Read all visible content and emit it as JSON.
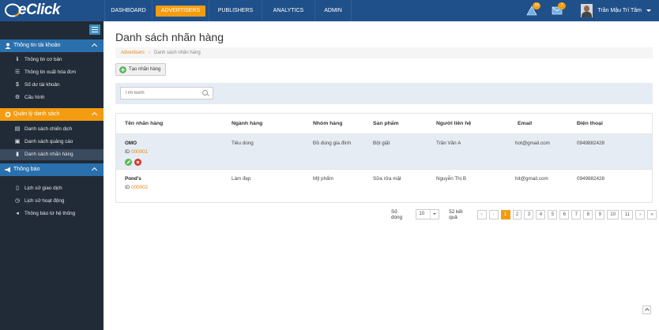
{
  "app": {
    "logo_text": "eClick"
  },
  "nav": [
    {
      "label": "DASHBOARD"
    },
    {
      "label": "ADVERTISERS",
      "active": true
    },
    {
      "label": "PUBLISHERS"
    },
    {
      "label": "ANALYTICS"
    },
    {
      "label": "ADMIN"
    }
  ],
  "notifications": {
    "alerts": "18",
    "messages": "7"
  },
  "user": {
    "name": "Trần Mậu Trí Tâm"
  },
  "sidebar": {
    "sections": [
      {
        "title": "Thông tin tài khoản",
        "items": [
          "Thông tin cơ bản",
          "Thông tin xuất hóa đơn",
          "Số dư tài khoản",
          "Cấu hình"
        ]
      },
      {
        "title": "Quản lý danh sách",
        "items": [
          "Danh sách chiến dịch",
          "Danh sách quảng cáo",
          "Danh sách nhãn hàng"
        ]
      },
      {
        "title": "Thông báo",
        "items": [
          "Lịch sử giao dịch",
          "Lịch sử hoạt động",
          "Thông báo từ hệ thống"
        ]
      }
    ]
  },
  "page": {
    "title": "Danh sách nhãn hàng",
    "breadcrumb": {
      "root": "Advertisers",
      "current": "Danh sách nhãn hàng"
    },
    "add_button": "Tạo nhãn hàng",
    "search_placeholder": "Tìm kiếm"
  },
  "table": {
    "headers": [
      "Tên nhãn hàng",
      "Ngành hàng",
      "Nhóm hàng",
      "Sản phẩm",
      "Người liên hệ",
      "Email",
      "Điện thoại"
    ],
    "rows": [
      {
        "name": "OMO",
        "id_label": "ID",
        "id": "000001",
        "industry": "Tiêu dùng",
        "group": "Đồ dùng gia đình",
        "product": "Bột giặt",
        "contact": "Trần Văn A",
        "email": "hot@gmail.com",
        "phone": "0949882428"
      },
      {
        "name": "Pond's",
        "id_label": "ID",
        "id": "000002",
        "industry": "Làm đẹp",
        "group": "Mỹ phẩm",
        "product": "Sữa rửa mặt",
        "contact": "Nguyễn Thị B",
        "email": "hit@gmail.com",
        "phone": "0949882428"
      }
    ]
  },
  "pagination": {
    "rows_label": "Số dòng",
    "rows_value": "10",
    "total": "52 kết quả",
    "pages": [
      "1",
      "2",
      "3",
      "4",
      "5",
      "6",
      "7",
      "8",
      "9",
      "10",
      "11"
    ],
    "current": "1"
  }
}
